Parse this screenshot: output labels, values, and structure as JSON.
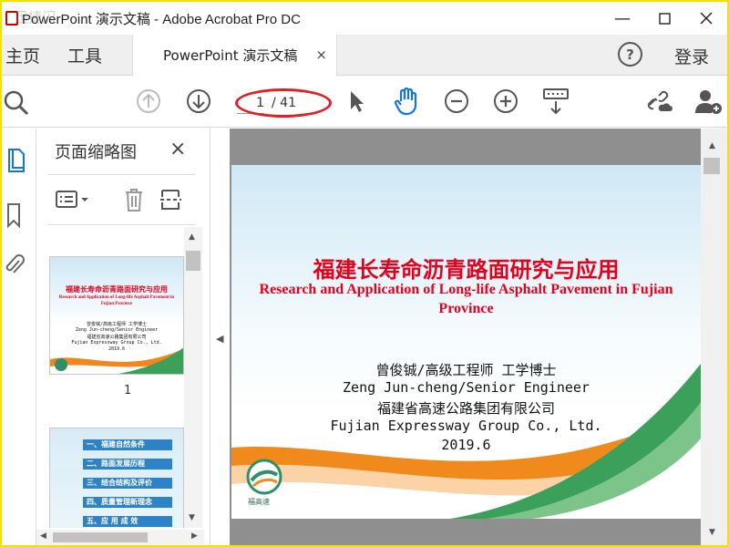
{
  "window": {
    "title": "PowerPoint 演示文稿 - Adobe Acrobat Pro DC",
    "controls": [
      "minimize-icon",
      "maximize-icon",
      "close-icon"
    ]
  },
  "tabs": {
    "home_label": "主页",
    "tools_label": "工具",
    "document_label": "PowerPoint 演示文稿",
    "document_close": "×",
    "help_glyph": "?",
    "login_label": "登录"
  },
  "toolbar": {
    "icons": [
      "zoom-search-icon",
      "page-up-icon",
      "page-down-icon",
      "select-arrow-icon",
      "hand-tool-icon",
      "zoom-out-icon",
      "zoom-in-icon",
      "keyboard-scroll-icon",
      "share-link-icon",
      "add-user-icon"
    ],
    "page_current": "1",
    "page_total": "/ 41",
    "highlight_color": "#e31e24",
    "hand_tool_active_color": "#1473e6"
  },
  "left_rail": {
    "icons": [
      "page-thumbnails-icon",
      "bookmark-icon",
      "attachment-icon"
    ]
  },
  "panel": {
    "title": "页面缩略图",
    "close": "×",
    "tools": [
      "thumbnail-options-icon",
      "delete-icon",
      "extract-pages-icon"
    ],
    "thumb1_number": "1",
    "thumb1": {
      "title_cn": "福建长寿命沥青路面研究与应用",
      "title_en_1": "Research and Application of Long-life Asphalt Pavement in",
      "title_en_2": "Fujian Province",
      "author_1": "曾俊铖/高级工程师 工学博士",
      "author_2": "Zeng Jun-cheng/Senior Engineer",
      "author_3": "福建省高速公路集团有限公司",
      "author_4": "Fujian Expressway Group Co., Ltd.",
      "author_5": "2019.6"
    },
    "thumb2_items": [
      "一、福建自然条件",
      "二、路面发展历程",
      "三、结合结构及评价",
      "四、质量管理新理念",
      "五、应 用 成 效"
    ]
  },
  "slide": {
    "title_cn": "福建长寿命沥青路面研究与应用",
    "title_en": "Research and Application of Long-life Asphalt Pavement in Fujian Province",
    "author_cn": "曾俊铖/高级工程师 工学博士",
    "author_en": "Zeng Jun-cheng/Senior Engineer",
    "org_cn": "福建省高速公路集团有限公司",
    "org_en": "Fujian Expressway Group Co., Ltd.",
    "date": "2019.6",
    "logo_text": "福高速"
  },
  "watermark": {
    "top_left": "迅捷闪"
  }
}
